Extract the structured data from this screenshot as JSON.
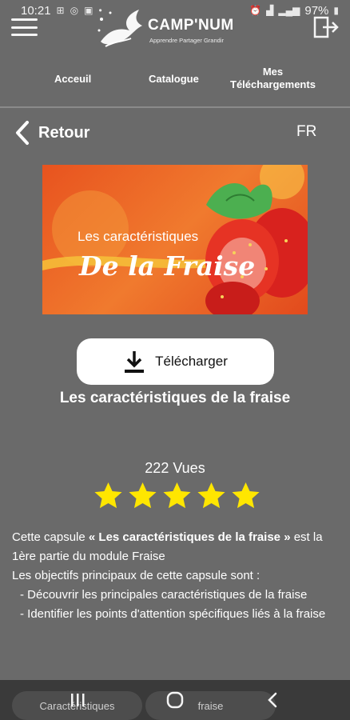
{
  "status_bar": {
    "time": "10:21",
    "battery": "97%"
  },
  "header": {
    "brand": "CAMP'NUM",
    "tagline": "Apprendre Partager Grandir"
  },
  "nav": {
    "tabs": [
      {
        "label": "Acceuil"
      },
      {
        "label": "Catalogue"
      },
      {
        "label_line1": "Mes",
        "label_line2": "Téléchargements"
      }
    ]
  },
  "back": {
    "label": "Retour"
  },
  "lang": "FR",
  "banner": {
    "line1": "Les caractéristiques",
    "line2": "De la Fraise"
  },
  "download": {
    "label": "Télécharger"
  },
  "title": "Les caractéristiques de la fraise",
  "views": "222 Vues",
  "rating": {
    "value": 5,
    "max": 5,
    "color": "#ffe600"
  },
  "description": {
    "p1_prefix": "Cette capsule ",
    "p1_bold": "« Les caractéristiques de la fraise »",
    "p1_suffix": " est la 1ère partie du module Fraise",
    "p2": "Les objectifs principaux de cette capsule sont :",
    "bullet1": "- Découvrir les principales caractéristiques de la fraise",
    "bullet2": "- Identifier les points d'attention spécifiques liés à la fraise"
  },
  "bottom": {
    "chip1": "Caractéristiques",
    "chip2": "fraise"
  }
}
